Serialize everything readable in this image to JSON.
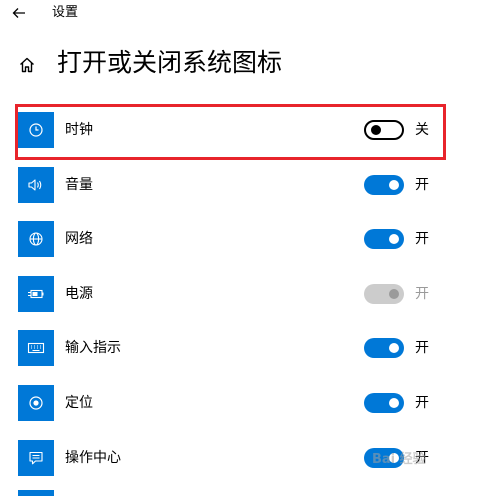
{
  "window": {
    "title": "设置"
  },
  "page": {
    "title": "打开或关闭系统图标"
  },
  "items": [
    {
      "label": "时钟",
      "icon": "clock-icon",
      "state": "off",
      "state_label": "关"
    },
    {
      "label": "音量",
      "icon": "volume-icon",
      "state": "on",
      "state_label": "开"
    },
    {
      "label": "网络",
      "icon": "network-globe-icon",
      "state": "on",
      "state_label": "开"
    },
    {
      "label": "电源",
      "icon": "battery-power-icon",
      "state": "disabled-on",
      "state_label": "开"
    },
    {
      "label": "输入指示",
      "icon": "keyboard-icon",
      "state": "on",
      "state_label": "开"
    },
    {
      "label": "定位",
      "icon": "location-target-icon",
      "state": "on",
      "state_label": "开"
    },
    {
      "label": "操作中心",
      "icon": "action-center-icon",
      "state": "on",
      "state_label": "开"
    }
  ],
  "highlight": {
    "color": "#e8242b",
    "target": "时钟"
  },
  "colors": {
    "accent": "#0078d7",
    "toggle_off_border": "#000000",
    "toggle_disabled": "#cccccc",
    "disabled_text": "#9a9a9a"
  },
  "watermark": {
    "text": "Bai 经验"
  }
}
